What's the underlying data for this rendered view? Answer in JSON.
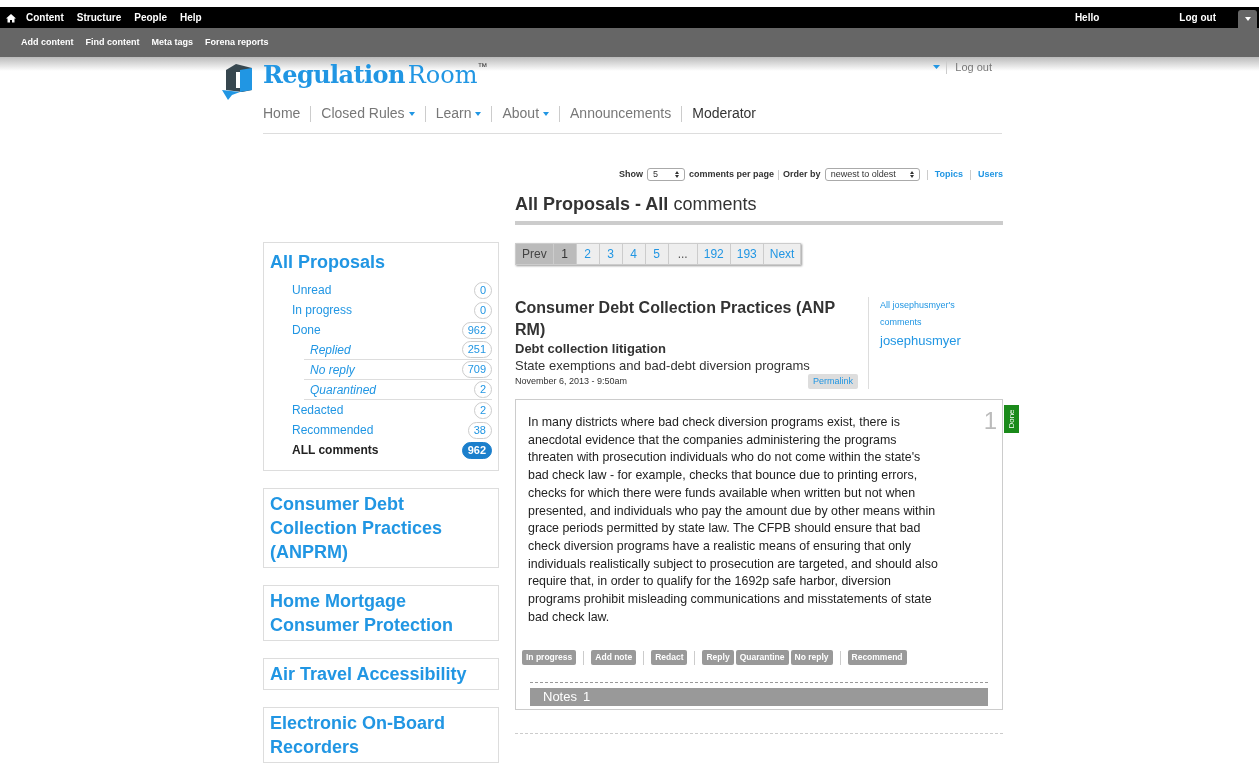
{
  "admin_menu": {
    "items": [
      "Content",
      "Structure",
      "People",
      "Help"
    ],
    "user_items": [
      "Hello",
      "Log out"
    ],
    "shortcuts": [
      "Add content",
      "Find content",
      "Meta tags",
      "Forena reports"
    ]
  },
  "site": {
    "logo_bold": "Regulation",
    "logo_light": "Room",
    "trademark": "™",
    "user_logout": "Log out"
  },
  "nav": [
    {
      "label": "Home",
      "dropdown": false,
      "selected": false
    },
    {
      "label": "Closed Rules",
      "dropdown": true,
      "selected": false
    },
    {
      "label": "Learn",
      "dropdown": true,
      "selected": false
    },
    {
      "label": "About",
      "dropdown": true,
      "selected": false
    },
    {
      "label": "Announcements",
      "dropdown": false,
      "selected": false
    },
    {
      "label": "Moderator",
      "dropdown": false,
      "selected": true
    }
  ],
  "controls": {
    "show_label": "Show",
    "per_page": "5",
    "per_page_suffix": "comments per page",
    "order_label": "Order by",
    "order": "newest to oldest",
    "links": [
      "Topics",
      "Users"
    ]
  },
  "heading": {
    "bold": "All Proposals - All",
    "light": "comments"
  },
  "pager": [
    {
      "label": "Prev",
      "kind": "nav",
      "selected": false,
      "disabled": true
    },
    {
      "label": "1",
      "kind": "page",
      "selected": true,
      "disabled": false
    },
    {
      "label": "2",
      "kind": "page",
      "selected": false,
      "disabled": false
    },
    {
      "label": "3",
      "kind": "page",
      "selected": false,
      "disabled": false
    },
    {
      "label": "4",
      "kind": "page",
      "selected": false,
      "disabled": false
    },
    {
      "label": "5",
      "kind": "page",
      "selected": false,
      "disabled": false
    },
    {
      "label": "...",
      "kind": "gap",
      "selected": false,
      "disabled": true
    },
    {
      "label": "192",
      "kind": "page",
      "selected": false,
      "disabled": false
    },
    {
      "label": "193",
      "kind": "page",
      "selected": false,
      "disabled": false
    },
    {
      "label": "Next",
      "kind": "nav",
      "selected": false,
      "disabled": false
    }
  ],
  "filters": {
    "title": "All Proposals",
    "items": [
      {
        "label": "Unread",
        "count": "0",
        "selected": false
      },
      {
        "label": "In progress",
        "count": "0",
        "selected": false
      },
      {
        "label": "Done",
        "count": "962",
        "selected": false,
        "children": [
          {
            "label": "Replied",
            "count": "251",
            "selected": false
          },
          {
            "label": "No reply",
            "count": "709",
            "selected": false
          },
          {
            "label": "Quarantined",
            "count": "2",
            "selected": false
          }
        ]
      },
      {
        "label": "Redacted",
        "count": "2",
        "selected": false
      },
      {
        "label": "Recommended",
        "count": "38",
        "selected": false
      },
      {
        "label": "ALL comments",
        "count": "962",
        "selected": true
      }
    ]
  },
  "proposals": [
    "Consumer Debt Collection Practices (ANPRM)",
    "Home Mortgage Consumer Protection",
    "Air Travel Accessibility",
    "Electronic On-Board Recorders"
  ],
  "comment": {
    "rule": "Consumer Debt Collection Practices (ANP RM)",
    "topic": "Debt collection litigation",
    "subtopic": "State exemptions and bad-debt diversion programs",
    "date": "November 6, 2013 - 9:50am",
    "permalink": "Permalink",
    "user_comments_link": "All josephusmyer's comments",
    "author": "josephusmyer",
    "number": "1",
    "status": "Done",
    "body": "In many districts where bad check diversion programs exist, there is anecdotal evidence that the companies administering the programs threaten with prosecution individuals who do not come within the state's bad check law - for example, checks that bounce due to printing errors, checks for which there were funds available when written but not when presented, and individuals who pay the amount due by other means within grace periods permitted by state law. The CFPB should ensure that bad check diversion programs have a realistic means of ensuring that only individuals realistically subject to prosecution are targeted, and should also require that, in order to qualify for the 1692p safe harbor, diversion programs prohibit misleading communications and misstatements of state bad check law.",
    "actions": [
      [
        "In progress"
      ],
      [
        "Add note"
      ],
      [
        "Redact"
      ],
      [
        "Reply",
        "Quarantine",
        "No reply"
      ],
      [
        "Recommend"
      ]
    ],
    "notes_label": "Notes",
    "notes_count": "1"
  }
}
